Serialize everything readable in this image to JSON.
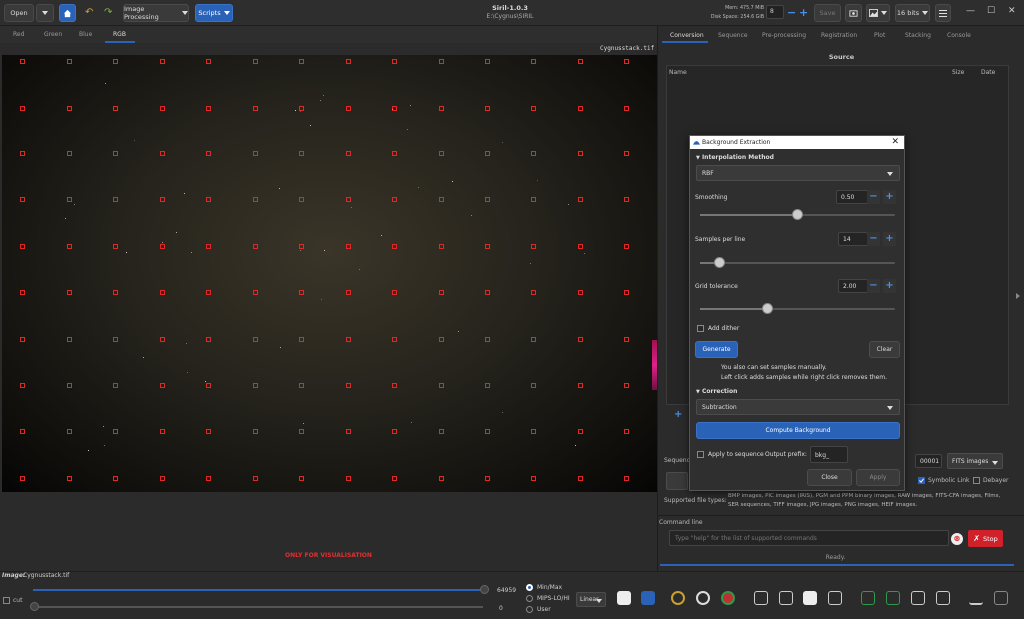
{
  "header": {
    "open_label": "Open",
    "image_processing_label": "Image Processing",
    "scripts_label": "Scripts",
    "app_title": "Siril-1.0.3",
    "app_path": "E:\\Cygnus\\SIRIL",
    "mem": "Mem: 475.7 MiB",
    "disk": "Disk Space: 254.6 GiB",
    "threads_value": "8",
    "save_label": "Save",
    "bits_label": "16 bits"
  },
  "channel_tabs": [
    "Red",
    "Green",
    "Blue",
    "RGB"
  ],
  "image_filename": "Cygnusstack.tif",
  "visualisation_notice": "ONLY FOR VISUALISATION",
  "right_tabs": [
    "Conversion",
    "Sequence",
    "Pre-processing",
    "Registration",
    "Plot",
    "Stacking",
    "Console"
  ],
  "source": {
    "title": "Source",
    "col_name": "Name",
    "col_size": "Size",
    "col_date": "Date"
  },
  "dialog": {
    "title": "Background Extraction",
    "interp_section": "Interpolation Method",
    "interp_value": "RBF",
    "smoothing_label": "Smoothing",
    "smoothing_value": "0.50",
    "smoothing_level": 0.5,
    "samples_label": "Samples per line",
    "samples_value": "14",
    "samples_level": 0.1,
    "tolerance_label": "Grid tolerance",
    "tolerance_value": "2.00",
    "tolerance_level": 0.35,
    "add_dither_label": "Add dither",
    "generate_label": "Generate",
    "clear_label": "Clear",
    "hint_line1": "You also can set samples manually.",
    "hint_line2": "Left click adds samples while right click removes them.",
    "correction_section": "Correction",
    "correction_value": "Subtraction",
    "compute_label": "Compute Background",
    "apply_seq_label": "Apply to sequence",
    "output_prefix_label": "Output prefix:",
    "output_prefix_value": "bkg_",
    "close_label": "Close",
    "apply_label": "Apply"
  },
  "conversion": {
    "sequence_label": "Sequenc",
    "index_value": "00001",
    "format_value": "FITS images",
    "symbolic_link_label": "Symbolic Link",
    "debayer_label": "Debayer",
    "supported_label": "Supported file types:",
    "supported_text1": "BMP images, PIC images (IRIS), PGM and PPM binary images, RAW images, FITS-CFA images, Films,",
    "supported_text2": "SER sequences, TIFF images, JPG images, PNG images, HEIF images."
  },
  "command": {
    "label": "Command line",
    "placeholder": "Type \"help\" for the list of supported commands",
    "stop_label": "Stop",
    "status": "Ready."
  },
  "bottom": {
    "image_label": "Image:",
    "image_value": "Cygnusstack.tif",
    "high_value": "64959",
    "low_value": "0",
    "cut_label": "cut",
    "minmax_label": "Min/Max",
    "mips_label": "MIPS-LO/HI",
    "user_label": "User",
    "scale_value": "Linear"
  },
  "colors": {
    "accent": "#2a62b8",
    "sample_box": "#e02828",
    "stop": "#d0202a"
  }
}
